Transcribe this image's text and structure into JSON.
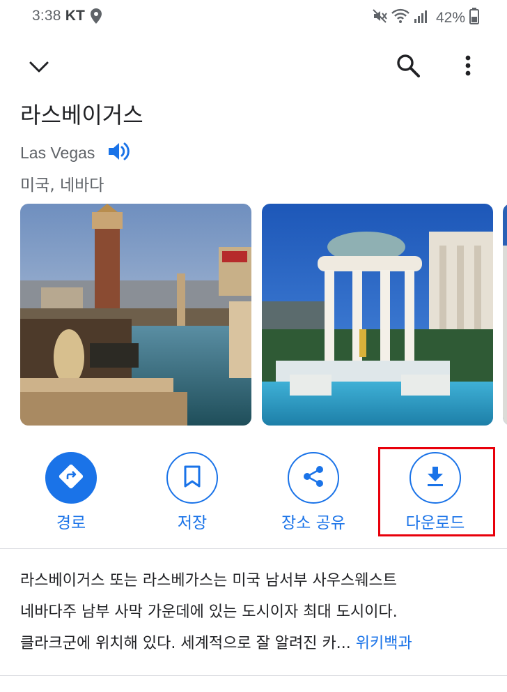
{
  "status_bar": {
    "time": "3:38",
    "carrier": "KT",
    "battery": "42%"
  },
  "place": {
    "title": "라스베이거스",
    "subtitle": "Las Vegas",
    "region": "미국, 네바다"
  },
  "actions": {
    "route": "경로",
    "save": "저장",
    "share": "장소 공유",
    "download": "다운로드"
  },
  "description": {
    "line1": "라스베이거스 또는 라스베가스는 미국 남서부 사우스웨스트",
    "line2": "네바다주 남부 사막 가운데에 있는 도시이자 최대 도시이다.",
    "line3": "클라크군에 위치해 있다. 세계적으로 잘 알려진 카...",
    "link": "위키백과"
  },
  "icons": {
    "back": "chevron-down-icon",
    "search": "search-icon",
    "more": "more-vert-icon",
    "speaker": "speaker-icon",
    "route": "directions-icon",
    "save": "bookmark-icon",
    "share": "share-icon",
    "download": "download-icon"
  },
  "colors": {
    "accent": "#1a73e8",
    "highlight": "#e8000b"
  }
}
